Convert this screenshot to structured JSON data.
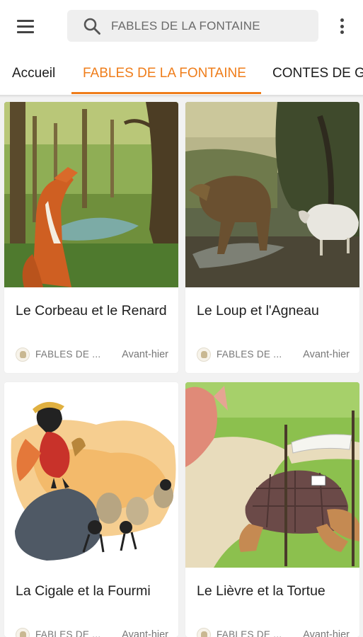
{
  "search": {
    "query": "FABLES DE LA FONTAINE"
  },
  "tabs": [
    {
      "label": "Accueil",
      "active": false
    },
    {
      "label": "FABLES DE LA FONTAINE",
      "active": true
    },
    {
      "label": "CONTES DE G",
      "active": false
    }
  ],
  "colors": {
    "accent": "#ef7d1a",
    "search_bg": "#efefef",
    "page_bg": "#f2f2f2"
  },
  "icons": {
    "menu": "hamburger-menu-icon",
    "search": "search-icon",
    "more": "more-vertical-icon"
  },
  "cards": [
    {
      "title": "Le Corbeau et le Renard",
      "source": "FABLES DE ...",
      "date": "Avant-hier",
      "image": "fox in forest illustration"
    },
    {
      "title": "Le Loup et l'Agneau",
      "source": "FABLES DE ...",
      "date": "Avant-hier",
      "image": "wolf and lamb painting"
    },
    {
      "title": "La Cigale et la Fourmi",
      "source": "FABLES DE ...",
      "date": "Avant-hier",
      "image": "cicada and ants illustration"
    },
    {
      "title": "Le Lièvre et la Tortue",
      "source": "FABLES DE ...",
      "date": "Avant-hier",
      "image": "hare and tortoise cartoon"
    }
  ]
}
